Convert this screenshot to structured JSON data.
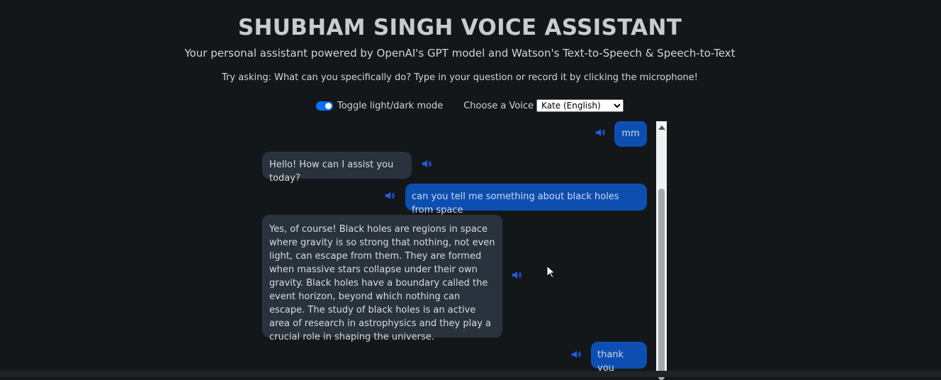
{
  "header": {
    "title": "SHUBHAM SINGH VOICE ASSISTANT",
    "subtitle": "Your personal assistant powered by OpenAI's GPT model and Watson's Text-to-Speech & Speech-to-Text",
    "hint": "Try asking: What can you specifically do? Type in your question or record it by clicking the microphone!"
  },
  "controls": {
    "toggle_label": "Toggle light/dark mode",
    "toggle_on": true,
    "voice_label": "Choose a Voice",
    "voice_selected": "Kate (English)"
  },
  "colors": {
    "background": "#141719",
    "user_bubble": "#0d4fb1",
    "bot_bubble": "#2a333d",
    "accent": "#0d6efd",
    "speaker_icon": "#1f5ff0"
  },
  "messages": [
    {
      "role": "user",
      "text": "mm"
    },
    {
      "role": "assistant",
      "text": "Hello! How can I assist you today?"
    },
    {
      "role": "user",
      "text": "can you tell me something about black holes from space"
    },
    {
      "role": "assistant",
      "text": "Yes, of course! Black holes are regions in space where gravity is so strong that nothing, not even light, can escape from them. They are formed when massive stars collapse under their own gravity. Black holes have a boundary called the event horizon, beyond which nothing can escape. The study of black holes is an active area of research in astrophysics and they play a crucial role in shaping the universe."
    },
    {
      "role": "user",
      "text": "thank you"
    }
  ],
  "icons": {
    "speaker": "speaker-icon",
    "scroll_up": "scroll-up-arrow-icon",
    "cursor": "mouse-pointer-icon"
  }
}
